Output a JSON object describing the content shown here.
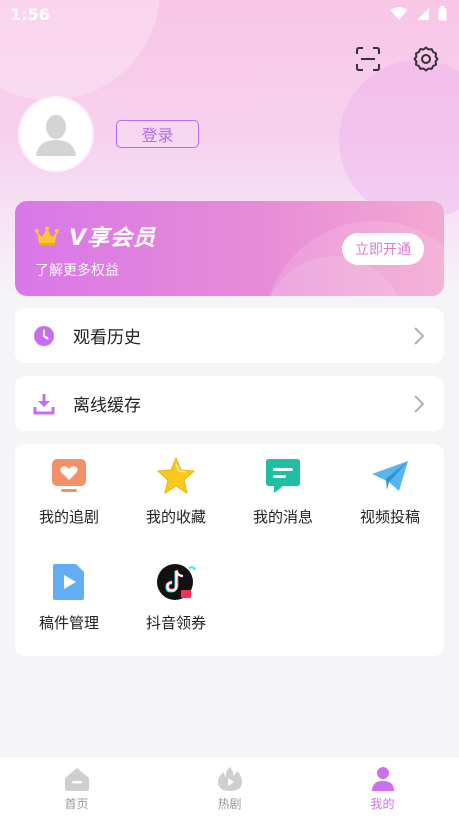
{
  "status": {
    "time": "1:56"
  },
  "header": {
    "scan_icon": "scan-icon",
    "settings_icon": "gear-icon",
    "login_label": "登录"
  },
  "vip": {
    "title": "V享会员",
    "subtitle": "了解更多权益",
    "button": "立即开通",
    "crown_icon": "crown-icon"
  },
  "rows": [
    {
      "label": "观看历史",
      "icon": "clock-icon"
    },
    {
      "label": "离线缓存",
      "icon": "download-icon"
    }
  ],
  "grid": [
    {
      "label": "我的追剧",
      "icon": "heart-tv-icon"
    },
    {
      "label": "我的收藏",
      "icon": "star-icon"
    },
    {
      "label": "我的消息",
      "icon": "message-icon"
    },
    {
      "label": "视频投稿",
      "icon": "paper-plane-icon"
    },
    {
      "label": "稿件管理",
      "icon": "video-file-icon"
    },
    {
      "label": "抖音领券",
      "icon": "tiktok-icon"
    }
  ],
  "tabs": [
    {
      "label": "首页",
      "icon": "home-icon",
      "active": false
    },
    {
      "label": "热剧",
      "icon": "fire-icon",
      "active": false
    },
    {
      "label": "我的",
      "icon": "user-icon",
      "active": true
    }
  ],
  "colors": {
    "accent": "#cc6ff1",
    "vip_gradient_start": "#d977e9",
    "vip_gradient_end": "#f3a8d2"
  }
}
